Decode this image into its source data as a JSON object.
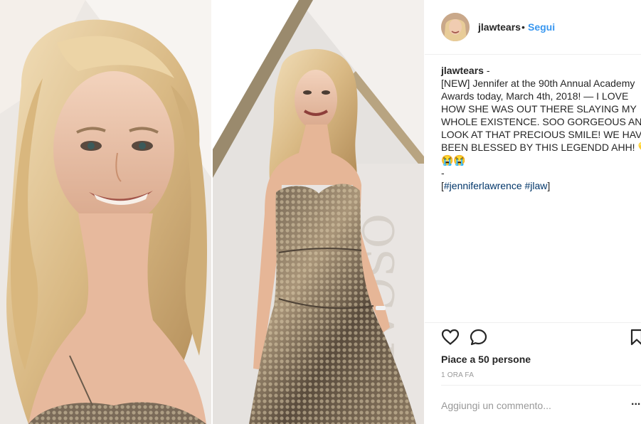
{
  "post": {
    "image_alt": "Jennifer Lawrence at the 90th Annual Academy Awards"
  },
  "header": {
    "username": "jlawtears",
    "separator": "•",
    "follow_label": "Segui"
  },
  "caption": {
    "username": "jlawtears",
    "after_user": " -",
    "lines": [
      "[NEW] Jennifer at the 90th Annual Academy",
      "Awards today, March 4th, 2018! — I LOVE",
      "HOW SHE WAS OUT THERE SLAYING MY",
      "WHOLE EXISTENCE. SOO GORGEOUS AND",
      "LOOK AT THAT PRECIOUS SMILE! WE HAVE SO",
      "BEEN BLESSED BY THIS LEGENDD AHH! 💛💛",
      "😭😭",
      "-"
    ],
    "tags_prefix": "[",
    "tags": [
      "#jenniferlawrence",
      "#jlaw"
    ],
    "tags_suffix": "]"
  },
  "actions": {
    "like_icon": "heart-icon",
    "comment_icon": "comment-icon",
    "save_icon": "bookmark-icon"
  },
  "likes_text": "Piace a 50 persone",
  "timestamp": "1 ORA FA",
  "comment": {
    "placeholder": "Aggiungi un commento...",
    "more_label": "..."
  },
  "colors": {
    "link": "#3897f0",
    "hashtag": "#003569",
    "text": "#262626",
    "muted": "#999999"
  }
}
